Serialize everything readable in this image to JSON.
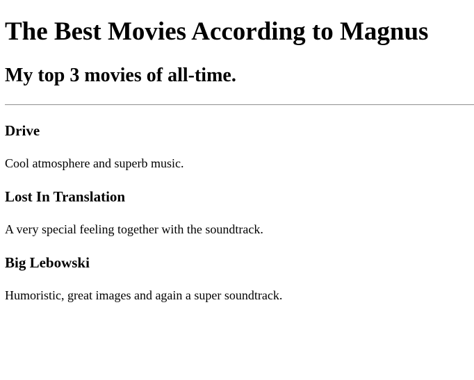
{
  "page": {
    "title": "The Best Movies According to Magnus",
    "subtitle": "My top 3 movies of all-time."
  },
  "movies": [
    {
      "title": "Drive",
      "description": "Cool atmosphere and superb music."
    },
    {
      "title": "Lost In Translation",
      "description": "A very special feeling together with the soundtrack."
    },
    {
      "title": "Big Lebowski",
      "description": "Humoristic, great images and again a super soundtrack."
    }
  ]
}
